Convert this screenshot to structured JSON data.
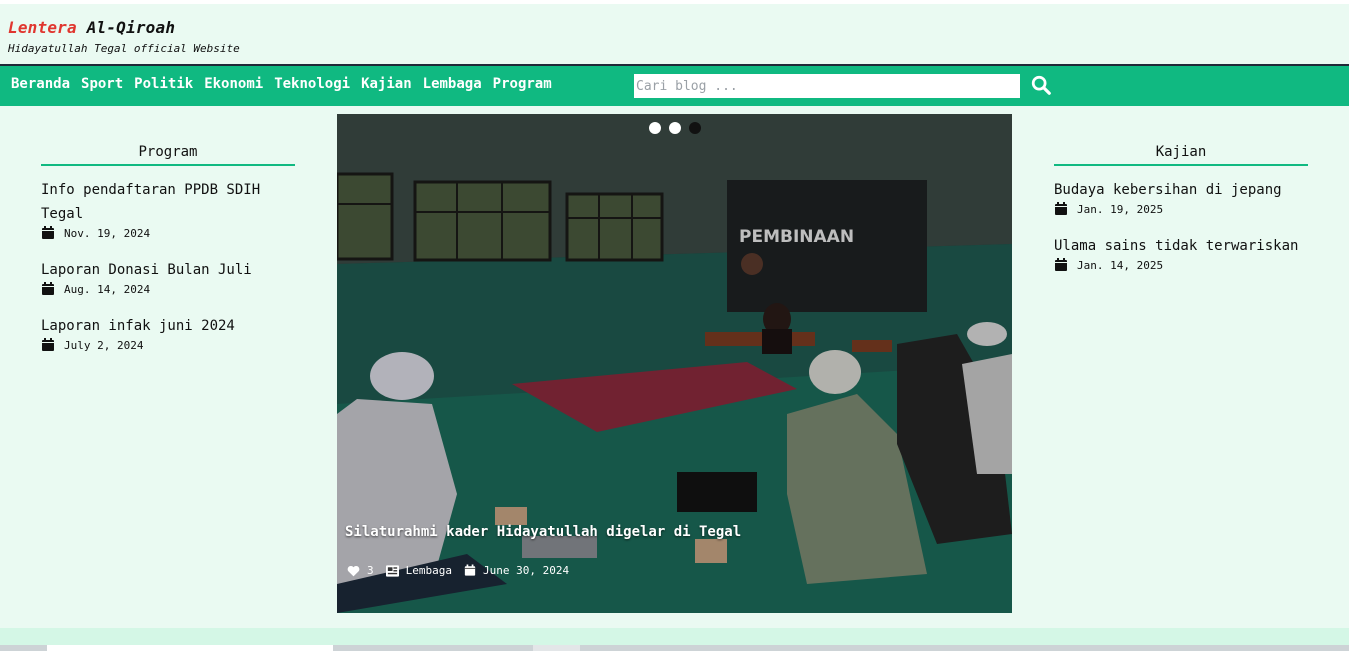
{
  "brand": {
    "title_word1": "Lentera",
    "title_word2": "Al-Qiroah",
    "tagline": "Hidayatullah Tegal official Website"
  },
  "nav": {
    "items": [
      "Beranda",
      "Sport",
      "Politik",
      "Ekonomi",
      "Teknologi",
      "Kajian",
      "Lembaga",
      "Program"
    ],
    "search_placeholder": "Cari blog ...",
    "search_value": "",
    "search_icon": "search-icon"
  },
  "left_sidebar": {
    "title": "Program",
    "posts": [
      {
        "title": "Info pendaftaran PPDB SDIH Tegal",
        "date": "Nov. 19, 2024"
      },
      {
        "title": "Laporan Donasi Bulan Juli",
        "date": "Aug. 14, 2024"
      },
      {
        "title": "Laporan infak juni 2024",
        "date": "July 2, 2024"
      }
    ]
  },
  "right_sidebar": {
    "title": "Kajian",
    "posts": [
      {
        "title": "Budaya kebersihan di jepang",
        "date": "Jan. 19, 2025"
      },
      {
        "title": "Ulama sains tidak terwariskan",
        "date": "Jan. 14, 2025"
      }
    ]
  },
  "slider": {
    "active_index": 1,
    "slides_count": 3,
    "caption": "Silaturahmi kader Hidayatullah digelar di Tegal",
    "likes": "3",
    "category": "Lembaga",
    "date": "June 30, 2024",
    "banner_heading": "PEMBINAAN"
  },
  "colors": {
    "brand_accent": "#e0362f",
    "nav_bg": "#10b981",
    "page_bg": "#eafaf2"
  }
}
